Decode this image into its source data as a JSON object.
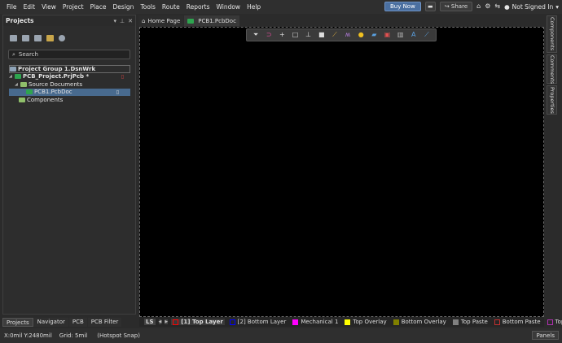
{
  "menubar": {
    "items": [
      "File",
      "Edit",
      "View",
      "Project",
      "Place",
      "Design",
      "Tools",
      "Route",
      "Reports",
      "Window",
      "Help"
    ],
    "buy_now": "Buy Now",
    "share": "Share",
    "user": "Not Signed In"
  },
  "projects_panel": {
    "title": "Projects",
    "search_placeholder": "Search",
    "tree": {
      "group": "Project Group 1.DsnWrk",
      "project": "PCB_Project.PrjPcb *",
      "source_docs": "Source Documents",
      "pcb_doc": "PCB1.PcbDoc",
      "components": "Components"
    },
    "bottom_tabs": [
      "Projects",
      "Navigator",
      "PCB",
      "PCB Filter"
    ]
  },
  "doc_tabs": [
    "Home Page",
    "PCB1.PcbDoc"
  ],
  "side_panels": [
    "Components",
    "Comments",
    "Properties"
  ],
  "layer_bar": {
    "ls": "LS",
    "layers": [
      {
        "name": "[1] Top Layer",
        "color": "#ff0000"
      },
      {
        "name": "[2] Bottom Layer",
        "color": "#0000ff"
      },
      {
        "name": "Mechanical 1",
        "color": "#ff00ff"
      },
      {
        "name": "Top Overlay",
        "color": "#ffff00"
      },
      {
        "name": "Bottom Overlay",
        "color": "#808000"
      },
      {
        "name": "Top Paste",
        "color": "#808080"
      },
      {
        "name": "Bottom Paste",
        "color": "#800000"
      },
      {
        "name": "Top Sold",
        "color": "#800080"
      }
    ]
  },
  "status": {
    "coords": "X:0mil Y:2480mil",
    "grid": "Grid: 5mil",
    "snap": "(Hotspot Snap)",
    "panels": "Panels"
  }
}
